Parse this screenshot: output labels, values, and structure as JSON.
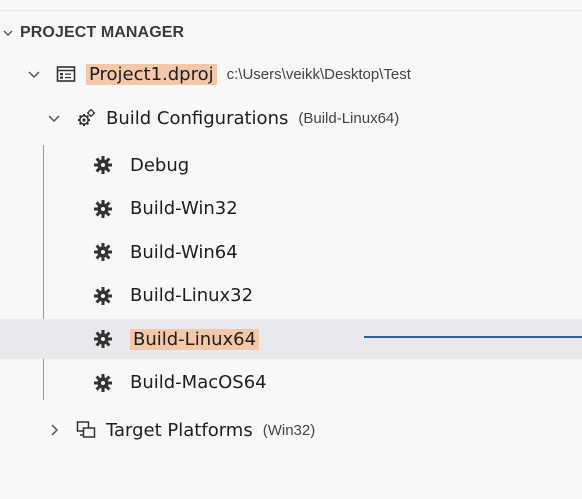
{
  "section": {
    "title": "PROJECT MANAGER"
  },
  "project": {
    "name": "Project1.dproj",
    "path": "c:\\Users\\veikk\\Desktop\\Test"
  },
  "build_configurations": {
    "label": "Build Configurations",
    "active": "(Build-Linux64)",
    "items": [
      {
        "label": "Debug"
      },
      {
        "label": "Build-Win32"
      },
      {
        "label": "Build-Win64"
      },
      {
        "label": "Build-Linux32"
      },
      {
        "label": "Build-Linux64",
        "selected": true
      },
      {
        "label": "Build-MacOS64"
      }
    ]
  },
  "target_platforms": {
    "label": "Target Platforms",
    "active": "(Win32)"
  },
  "colors": {
    "highlight": "#f4c7a9",
    "selection_row": "#e8e8ee",
    "connector": "#2f5f9e"
  }
}
